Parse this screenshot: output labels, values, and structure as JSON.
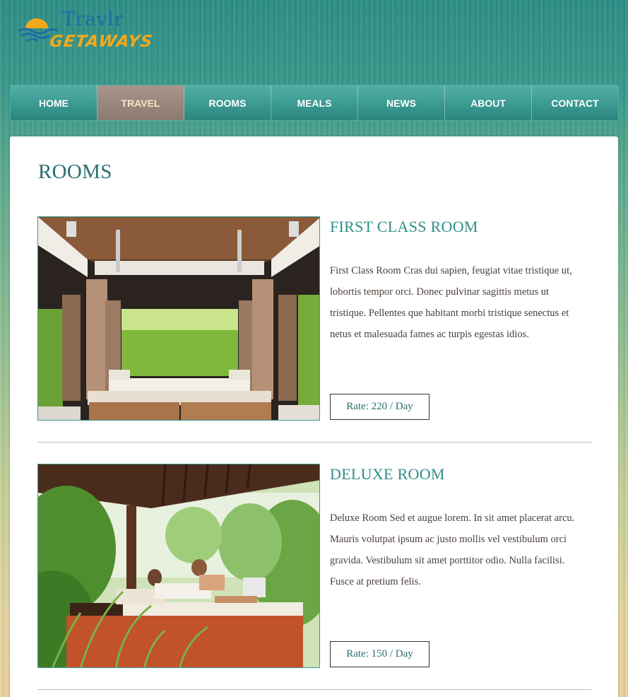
{
  "brand": {
    "title": "Travlr",
    "subtitle": "GETAWAYS"
  },
  "nav": [
    {
      "label": "HOME",
      "active": false
    },
    {
      "label": "TRAVEL",
      "active": true
    },
    {
      "label": "ROOMS",
      "active": false
    },
    {
      "label": "MEALS",
      "active": false
    },
    {
      "label": "NEWS",
      "active": false
    },
    {
      "label": "ABOUT",
      "active": false
    },
    {
      "label": "CONTACT",
      "active": false
    }
  ],
  "page": {
    "title": "ROOMS"
  },
  "rooms": [
    {
      "title": "FIRST CLASS ROOM",
      "description": "First Class Room Cras dui sapien, feugiat vitae tristique ut, lobortis tempor orci. Donec pulvinar sagittis metus ut tristique. Pellentes que habitant morbi tristique senectus et netus et malesuada fames ac turpis egestas idios.",
      "rate": "Rate: 220 / Day",
      "image": "luxury-pavilion-bedroom-photo"
    },
    {
      "title": "DELUXE ROOM",
      "description": "Deluxe Room Sed et augue lorem. In sit amet placerat arcu. Mauris volutpat ipsum ac justo mollis vel vestibulum orci gravida. Vestibulum sit amet porttitor odio. Nulla facilisi. Fusce at pretium felis.",
      "rate": "Rate: 150 / Day",
      "image": "couple-on-garden-daybed-photo"
    }
  ],
  "colors": {
    "accent": "#2e8f87",
    "nav_active": "#8c7a70",
    "brand_blue": "#1f6aa5",
    "brand_orange": "#f2a81d"
  }
}
